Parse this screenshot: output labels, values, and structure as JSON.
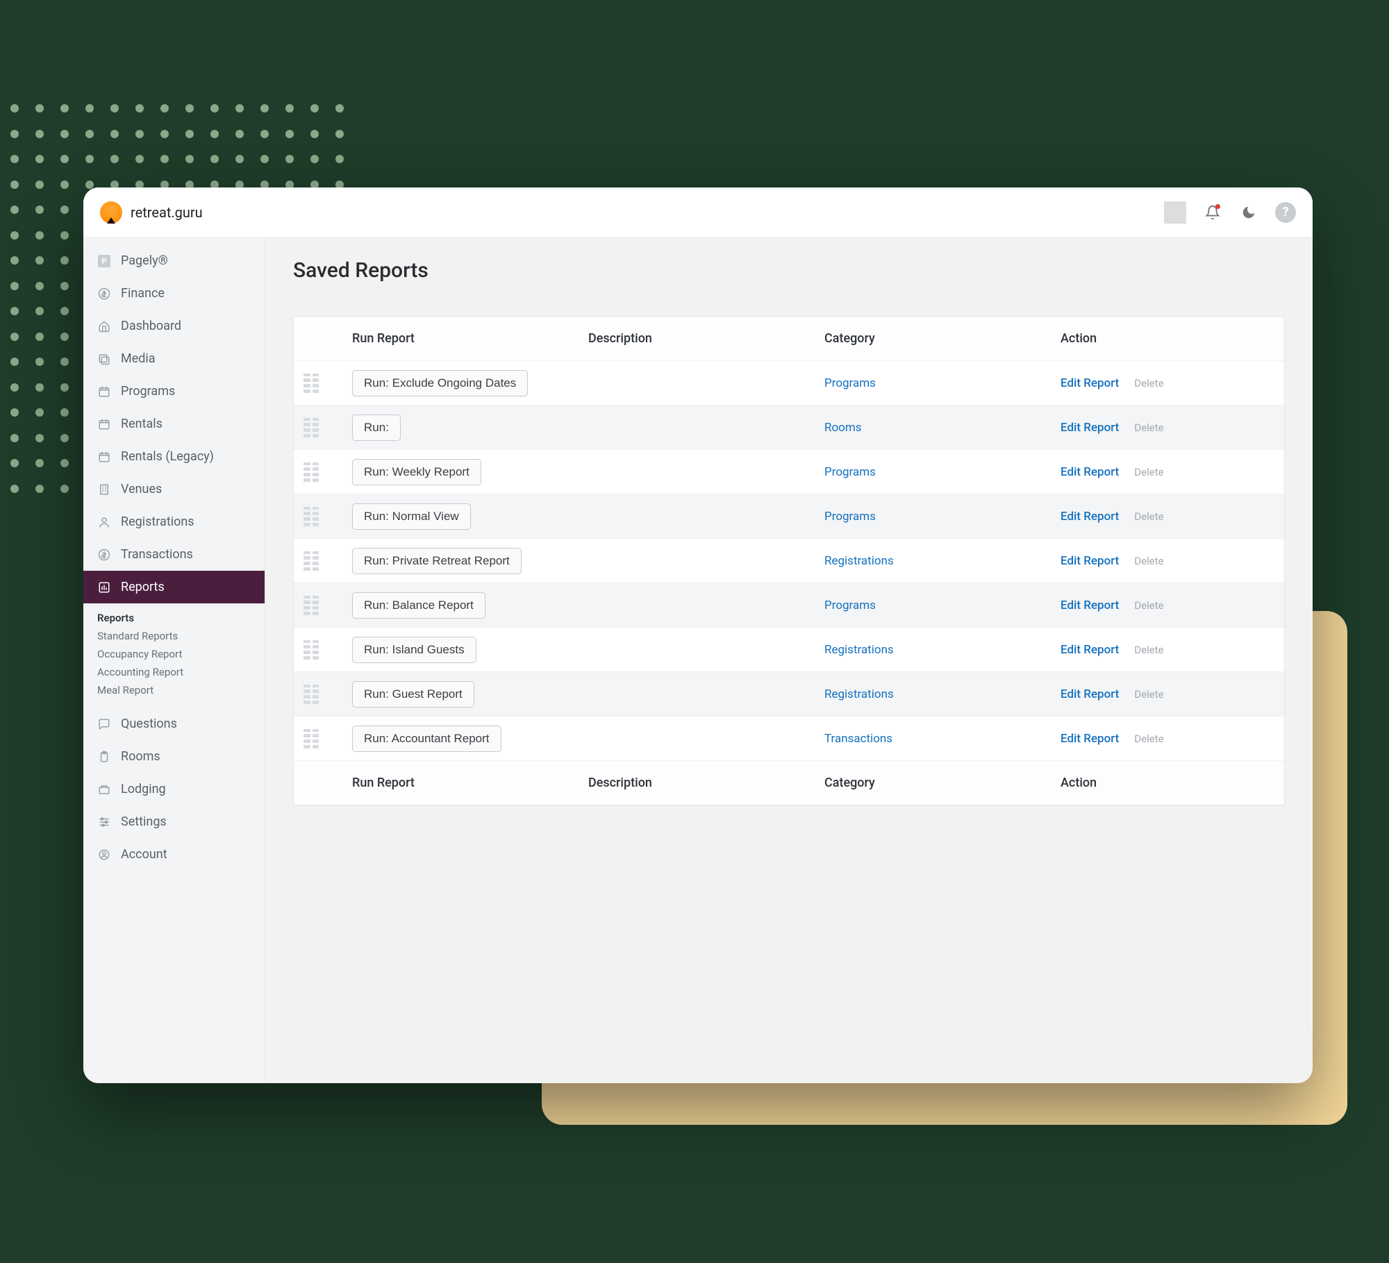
{
  "brand": "retreat.guru",
  "page_title": "Saved Reports",
  "sidebar": {
    "items": [
      {
        "label": "Pagely®",
        "icon": "P"
      },
      {
        "label": "Finance",
        "icon": "dollar"
      },
      {
        "label": "Dashboard",
        "icon": "home"
      },
      {
        "label": "Media",
        "icon": "media"
      },
      {
        "label": "Programs",
        "icon": "calendar"
      },
      {
        "label": "Rentals",
        "icon": "calendar"
      },
      {
        "label": "Rentals (Legacy)",
        "icon": "calendar"
      },
      {
        "label": "Venues",
        "icon": "building"
      },
      {
        "label": "Registrations",
        "icon": "user"
      },
      {
        "label": "Transactions",
        "icon": "dollar"
      },
      {
        "label": "Reports",
        "icon": "chart",
        "active": true
      },
      {
        "label": "Questions",
        "icon": "chat"
      },
      {
        "label": "Rooms",
        "icon": "clipboard"
      },
      {
        "label": "Lodging",
        "icon": "lodging"
      },
      {
        "label": "Settings",
        "icon": "sliders"
      },
      {
        "label": "Account",
        "icon": "account"
      }
    ],
    "subitems": [
      "Reports",
      "Standard Reports",
      "Occupancy Report",
      "Accounting Report",
      "Meal Report"
    ]
  },
  "table": {
    "headers": {
      "run": "Run Report",
      "description": "Description",
      "category": "Category",
      "action": "Action"
    },
    "edit_label": "Edit Report",
    "delete_label": "Delete",
    "rows": [
      {
        "run": "Run: Exclude Ongoing Dates",
        "category": "Programs"
      },
      {
        "run": "Run:",
        "category": "Rooms"
      },
      {
        "run": "Run: Weekly Report",
        "category": "Programs"
      },
      {
        "run": "Run: Normal View",
        "category": "Programs"
      },
      {
        "run": "Run: Private Retreat Report",
        "category": "Registrations"
      },
      {
        "run": "Run: Balance Report",
        "category": "Programs"
      },
      {
        "run": "Run: Island Guests",
        "category": "Registrations"
      },
      {
        "run": "Run: Guest Report",
        "category": "Registrations"
      },
      {
        "run": "Run: Accountant Report",
        "category": "Transactions"
      }
    ]
  }
}
